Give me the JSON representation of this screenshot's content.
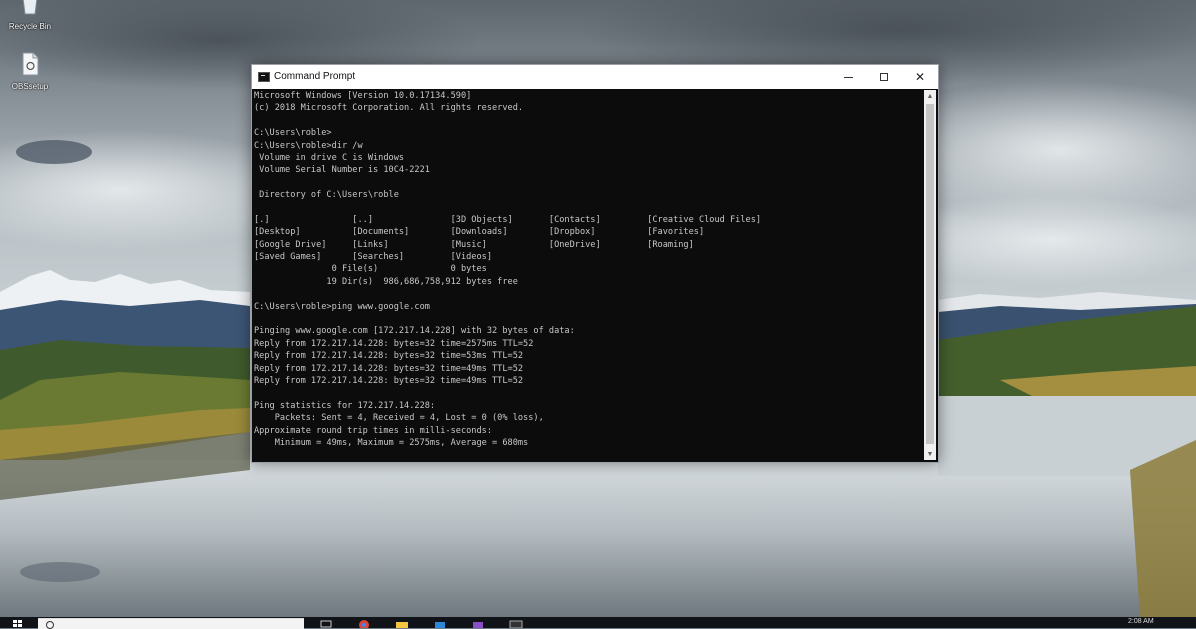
{
  "desktop": {
    "icons": [
      {
        "label": "Recycle Bin",
        "icon": "recycle-bin-icon"
      },
      {
        "label": "OBSsetup",
        "icon": "file-icon"
      }
    ]
  },
  "window": {
    "title": "Command Prompt",
    "icon": "console-icon",
    "controls": {
      "minimize": "minimize-icon",
      "maximize": "maximize-icon",
      "close": "✕"
    }
  },
  "console": {
    "lines": [
      "Microsoft Windows [Version 10.0.17134.590]",
      "(c) 2018 Microsoft Corporation. All rights reserved.",
      "",
      "C:\\Users\\roble>",
      "C:\\Users\\roble>dir /w",
      " Volume in drive C is Windows",
      " Volume Serial Number is 10C4-2221",
      "",
      " Directory of C:\\Users\\roble",
      "",
      "[.]                [..]               [3D Objects]       [Contacts]         [Creative Cloud Files]",
      "[Desktop]          [Documents]        [Downloads]        [Dropbox]          [Favorites]",
      "[Google Drive]     [Links]            [Music]            [OneDrive]         [Roaming]",
      "[Saved Games]      [Searches]         [Videos]",
      "               0 File(s)              0 bytes",
      "              19 Dir(s)  986,686,758,912 bytes free",
      "",
      "C:\\Users\\roble>ping www.google.com",
      "",
      "Pinging www.google.com [172.217.14.228] with 32 bytes of data:",
      "Reply from 172.217.14.228: bytes=32 time=2575ms TTL=52",
      "Reply from 172.217.14.228: bytes=32 time=53ms TTL=52",
      "Reply from 172.217.14.228: bytes=32 time=49ms TTL=52",
      "Reply from 172.217.14.228: bytes=32 time=49ms TTL=52",
      "",
      "Ping statistics for 172.217.14.228:",
      "    Packets: Sent = 4, Received = 4, Lost = 0 (0% loss),",
      "Approximate round trip times in milli-seconds:",
      "    Minimum = 49ms, Maximum = 2575ms, Average = 680ms"
    ]
  },
  "taskbar": {
    "start_icon": "windows-start-icon",
    "search_icon": "search-icon",
    "apps": [
      "task-view-icon",
      "chrome-icon",
      "file-explorer-icon",
      "store-icon",
      "app-icon",
      "command-prompt-icon"
    ],
    "clock": "2:08 AM"
  }
}
